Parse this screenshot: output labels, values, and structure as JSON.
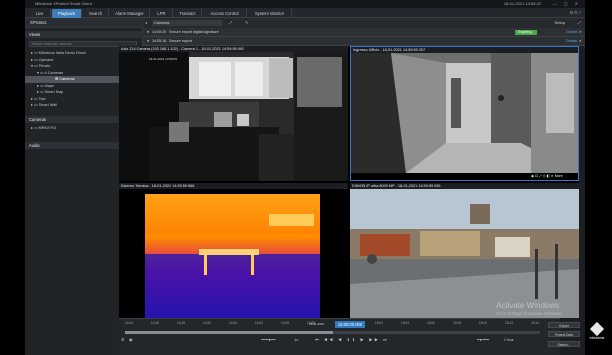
{
  "window": {
    "title": "Milestone XProtect Smart Client",
    "datetime": "18-01-2021 14:55:22",
    "controls": "— ▢ ✕"
  },
  "tabs": [
    {
      "label": "Live"
    },
    {
      "label": "Playback",
      "active": true
    },
    {
      "label": "Search"
    },
    {
      "label": "Alarm Manager"
    },
    {
      "label": "LPR"
    },
    {
      "label": "Transact"
    },
    {
      "label": "Access Control"
    },
    {
      "label": "System Monitor"
    }
  ],
  "tabs_right": "⚙ ⊡ ?",
  "app_header": "XProtect",
  "views": {
    "header": "Views",
    "search_placeholder": "Search views and cameras",
    "items": [
      {
        "label": "Milestone Italia Demo Room",
        "indent": 1
      },
      {
        "label": "Operator",
        "indent": 1
      },
      {
        "label": "Private",
        "indent": 1
      },
      {
        "label": "4 Cameras",
        "indent": 2
      },
      {
        "label": "Cameras",
        "indent": 3,
        "selected": true
      },
      {
        "label": "Maps",
        "indent": 2
      },
      {
        "label": "Smart Map",
        "indent": 2
      },
      {
        "label": "Test",
        "indent": 1
      },
      {
        "label": "Smart Wall",
        "indent": 1
      }
    ]
  },
  "cameras_panel": {
    "header": "Cameras",
    "items": [
      {
        "label": "MRKXY01"
      }
    ]
  },
  "audio_panel": {
    "header": "Audio"
  },
  "toolbar": {
    "view_name": "Cameras",
    "setup_label": "Setup"
  },
  "notifications": [
    {
      "time": "14:55:20",
      "text": "Secure export digital signature",
      "progress_label": "Exporting...",
      "action": "Cancel"
    },
    {
      "time": "14:55:16",
      "text": "Secure export",
      "action": "Details"
    }
  ],
  "cameras": [
    {
      "title": "Axis 214 Camera (192.168.1.102) - Camera 1 - 18-01-2021 14:59:59.992",
      "overlay": "18-01-2021 14:59:59"
    },
    {
      "title": "Ingresso Ufficio - 18-01-2021 14:59:59.207"
    },
    {
      "title": "Esterno Termica - 18-01-2021 14:59:59.968"
    },
    {
      "title": "DINION IP ultra 8000 MP - 18-01-2021 14:59:59.936"
    }
  ],
  "camera_controls": "◉ ⊡ ⤢ ⎙ ◧ ✕",
  "camera_controls_more": "More",
  "timeline": {
    "current_time": "15:00:00.000",
    "date_label": "18-01-2021",
    "ticks": [
      "14:44",
      "14:46",
      "14:48",
      "14:50",
      "14:52",
      "14:54",
      "14:56",
      "14:58",
      "15:00",
      "15:02",
      "15:04",
      "15:06",
      "15:08",
      "15:10",
      "15:12",
      "15:14"
    ],
    "progress": 0.5,
    "speed": "1x",
    "time_span": "1 Hour"
  },
  "side_buttons": {
    "export": "Export",
    "protect": "Protect Data",
    "search": "Search..."
  },
  "watermark": {
    "title": "Activate Windows",
    "subtitle": "Go to Settings to activate Windows."
  },
  "brand": {
    "name": "milestone"
  }
}
